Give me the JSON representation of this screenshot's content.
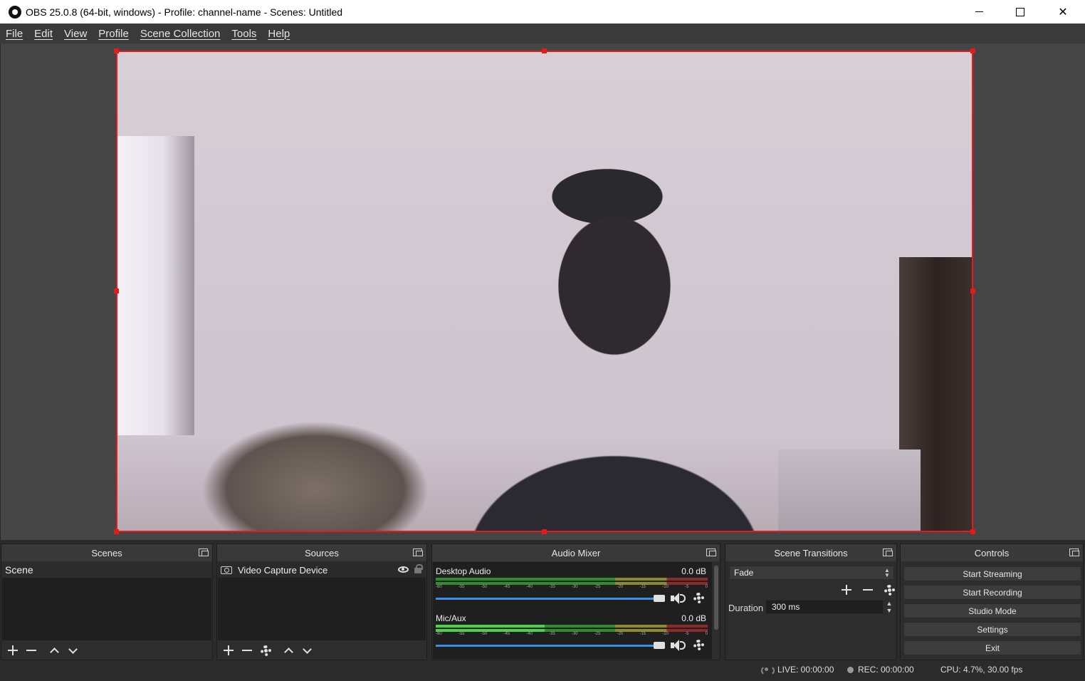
{
  "window": {
    "title": "OBS 25.0.8 (64-bit, windows) - Profile: channel-name - Scenes: Untitled"
  },
  "menu": [
    "File",
    "Edit",
    "View",
    "Profile",
    "Scene Collection",
    "Tools",
    "Help"
  ],
  "docks": {
    "scenes": {
      "title": "Scenes",
      "items": [
        "Scene"
      ]
    },
    "sources": {
      "title": "Sources",
      "items": [
        "Video Capture Device"
      ]
    },
    "mixer": {
      "title": "Audio Mixer",
      "channels": [
        {
          "name": "Desktop Audio",
          "level": "0.0 dB"
        },
        {
          "name": "Mic/Aux",
          "level": "0.0 dB"
        }
      ],
      "ticks": [
        "-60",
        "-55",
        "-50",
        "-45",
        "-40",
        "-35",
        "-30",
        "-25",
        "-20",
        "-15",
        "-10",
        "-5",
        "0"
      ]
    },
    "transitions": {
      "title": "Scene Transitions",
      "selected": "Fade",
      "duration_label": "Duration",
      "duration_value": "300 ms"
    },
    "controls": {
      "title": "Controls",
      "buttons": [
        "Start Streaming",
        "Start Recording",
        "Studio Mode",
        "Settings",
        "Exit"
      ]
    }
  },
  "status": {
    "live": "LIVE: 00:00:00",
    "rec": "REC: 00:00:00",
    "cpu": "CPU: 4.7%, 30.00 fps"
  },
  "colors": {
    "selection": "#e21c1c",
    "volume_slider": "#3a8ee6",
    "meter_green": "#4cd14c"
  }
}
